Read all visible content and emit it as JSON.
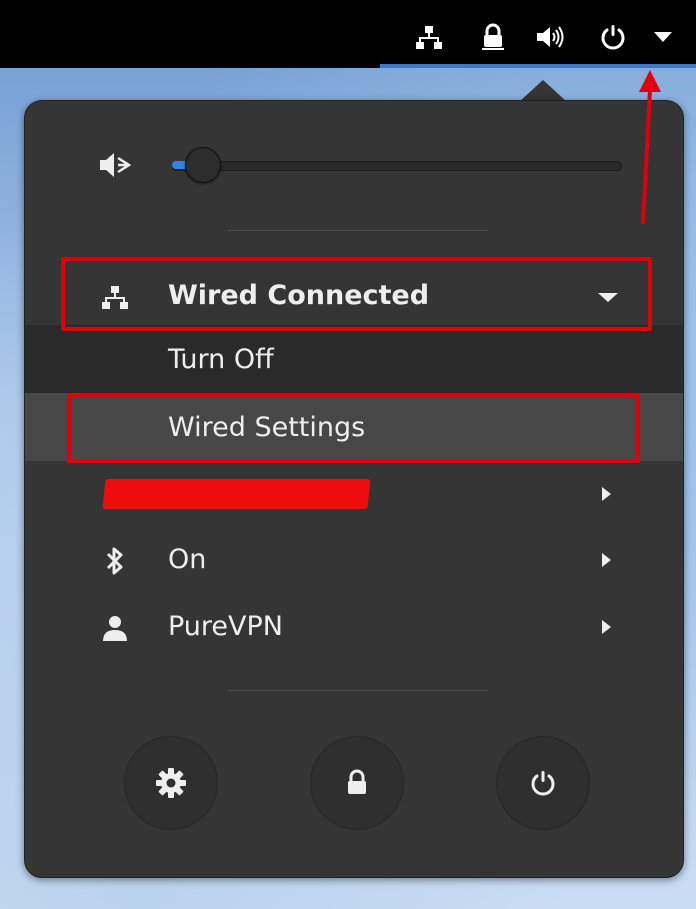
{
  "topbar": {
    "icons": [
      "network-wired-icon",
      "lock-icon",
      "volume-icon",
      "power-icon",
      "menu-dropdown-icon"
    ]
  },
  "volume": {
    "icon": "volume-muted-icon",
    "level": 0.06
  },
  "network": {
    "label": "Wired Connected",
    "icon": "network-wired-icon",
    "submenu": {
      "turn_off": "Turn Off",
      "settings": "Wired Settings"
    }
  },
  "redacted_item": {
    "label": ""
  },
  "bluetooth": {
    "label": "On",
    "icon": "bluetooth-icon"
  },
  "user": {
    "label": "PureVPN",
    "icon": "user-icon"
  },
  "actions": [
    {
      "name": "settings",
      "icon": "gear-icon"
    },
    {
      "name": "lock",
      "icon": "lock-icon"
    },
    {
      "name": "power",
      "icon": "power-icon"
    }
  ],
  "colors": {
    "panel": "#353535",
    "accent": "#3584e4",
    "annotation": "#e0000a"
  }
}
